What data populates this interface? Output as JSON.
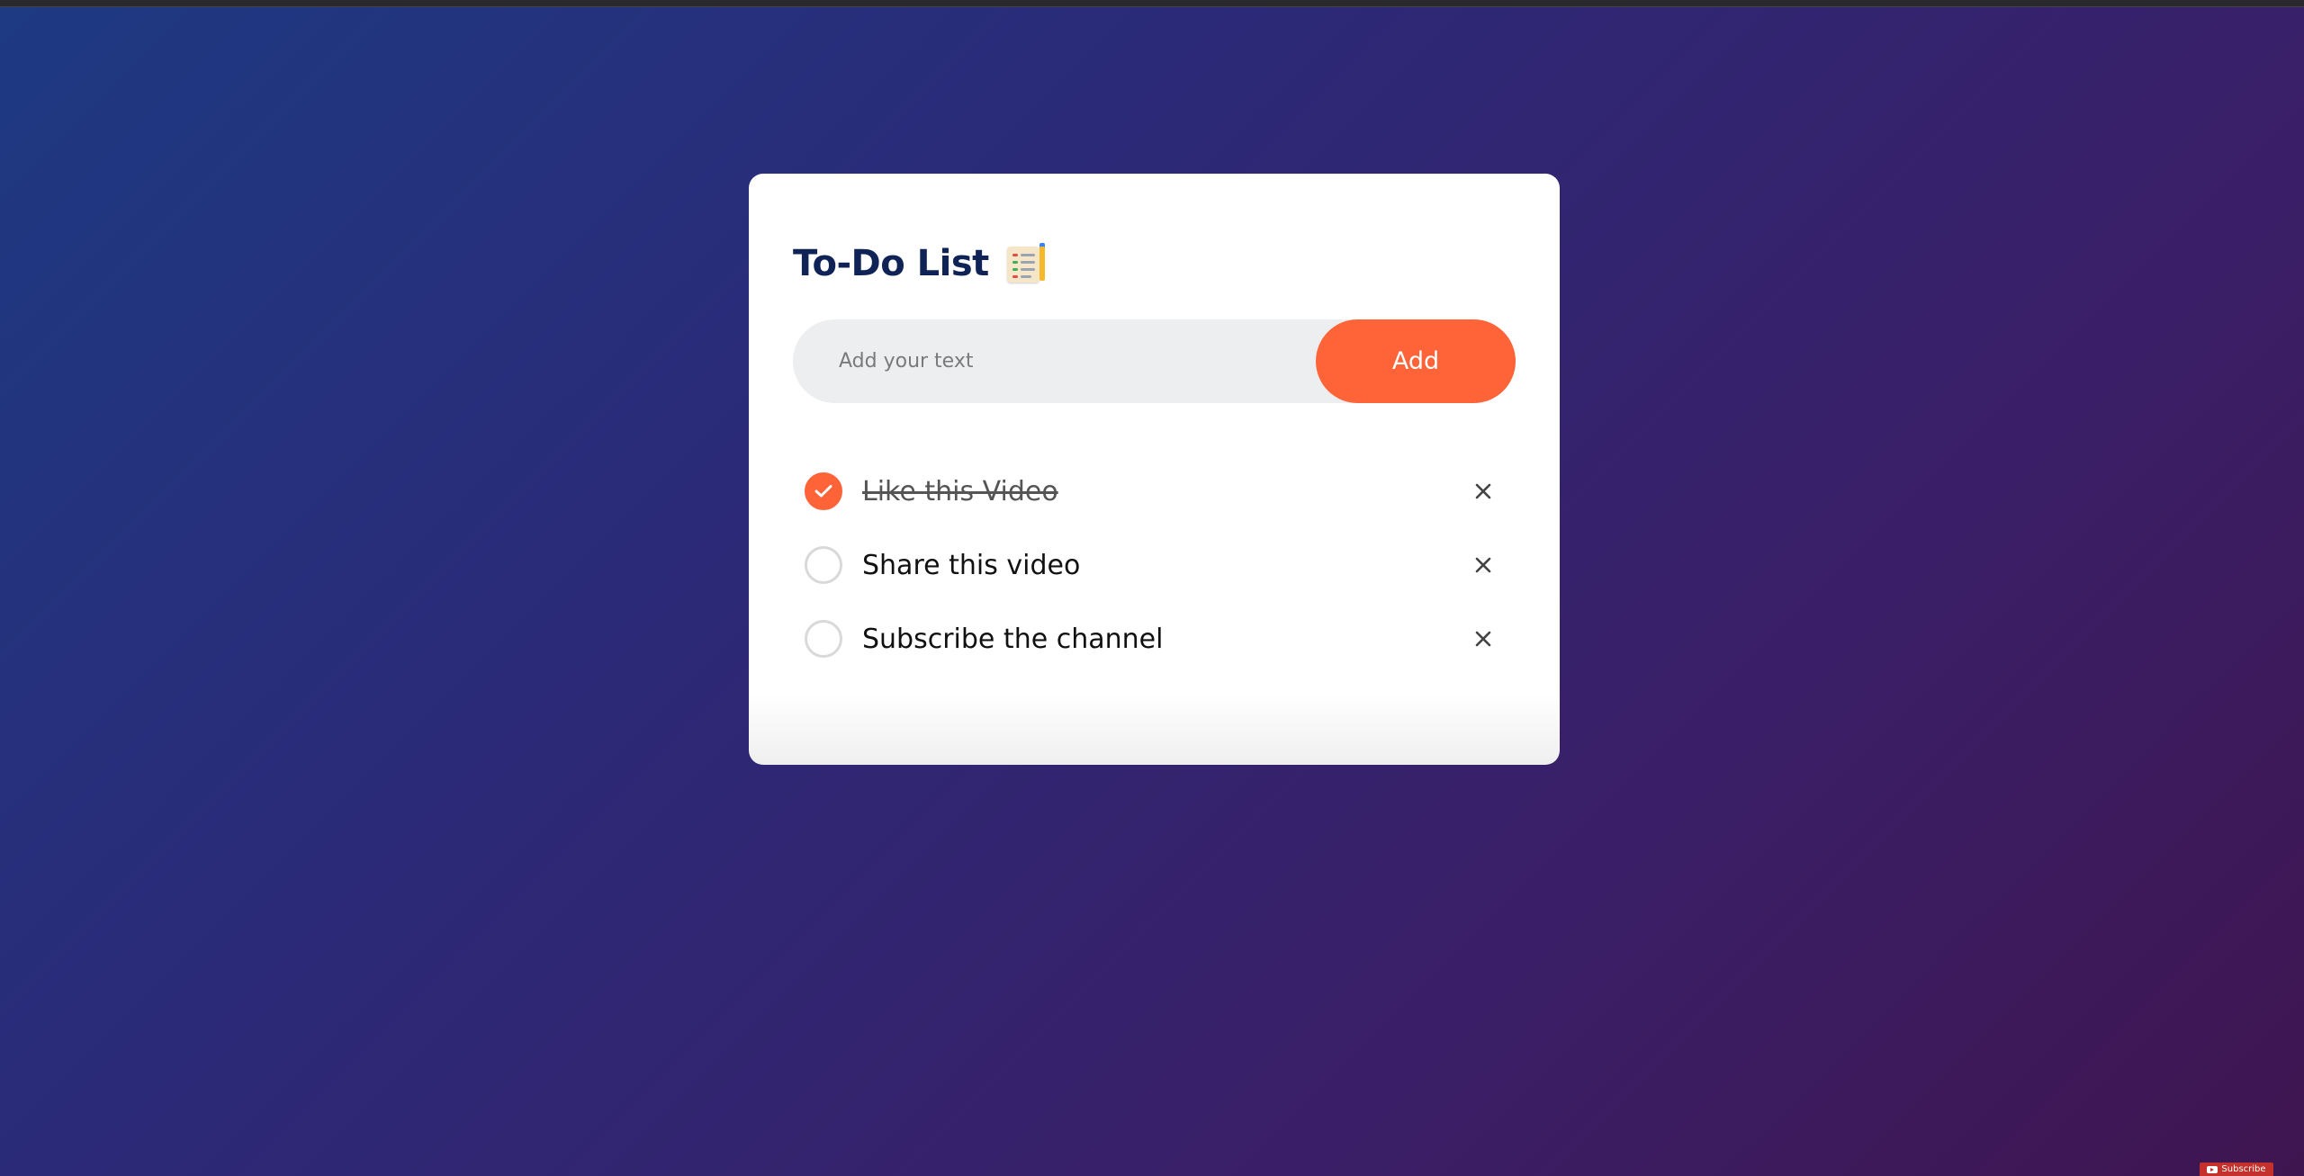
{
  "app": {
    "title": "To-Do List",
    "title_icon": "notepad-pencil-icon"
  },
  "input": {
    "placeholder": "Add your text",
    "value": "",
    "add_label": "Add"
  },
  "todos": [
    {
      "text": "Like this Video",
      "checked": true
    },
    {
      "text": "Share this video",
      "checked": false
    },
    {
      "text": "Subscribe the channel",
      "checked": false
    }
  ],
  "overlay": {
    "subscribe_label": "Subscribe"
  },
  "colors": {
    "accent": "#ff6338",
    "title": "#0f2356",
    "input_bg": "#edeef0",
    "unchecked_border": "#d9d9d9"
  }
}
